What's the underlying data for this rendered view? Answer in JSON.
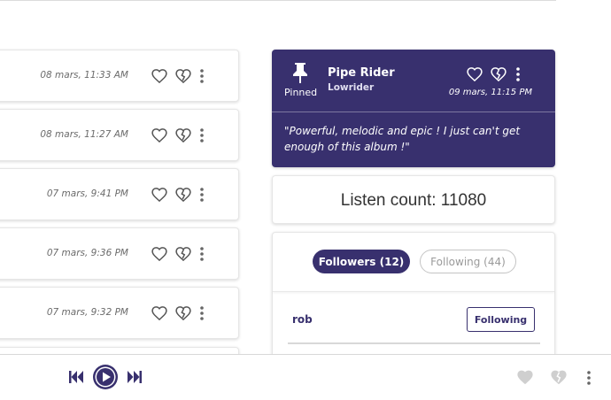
{
  "listens": [
    {
      "time": "08 mars, 11:33 AM"
    },
    {
      "time": "08 mars, 11:27 AM"
    },
    {
      "time": "07 mars, 9:41 PM"
    },
    {
      "time": "07 mars, 9:36 PM"
    },
    {
      "time": "07 mars, 9:32 PM"
    }
  ],
  "pinned": {
    "label": "Pinned",
    "title": "Pipe Rider",
    "artist": "Lowrider",
    "time": "09 mars, 11:15 PM",
    "quote": "\"Powerful, melodic and epic ! I just can't get enough of this album !\""
  },
  "listen_count": {
    "text": "Listen count: 11080"
  },
  "follow": {
    "tabs": {
      "followers": "Followers (12)",
      "following": "Following (44)"
    },
    "users": [
      {
        "name": "rob",
        "button": "Following"
      }
    ]
  },
  "icons": {
    "heart": "heart-outline-icon",
    "broken": "broken-heart-icon",
    "menu": "kebab-menu-icon",
    "pin": "pin-icon",
    "prev": "skip-previous-icon",
    "play": "play-icon",
    "next": "skip-next-icon"
  },
  "colors": {
    "accent": "#38306e",
    "muted_icon": "#c8c8c8"
  }
}
